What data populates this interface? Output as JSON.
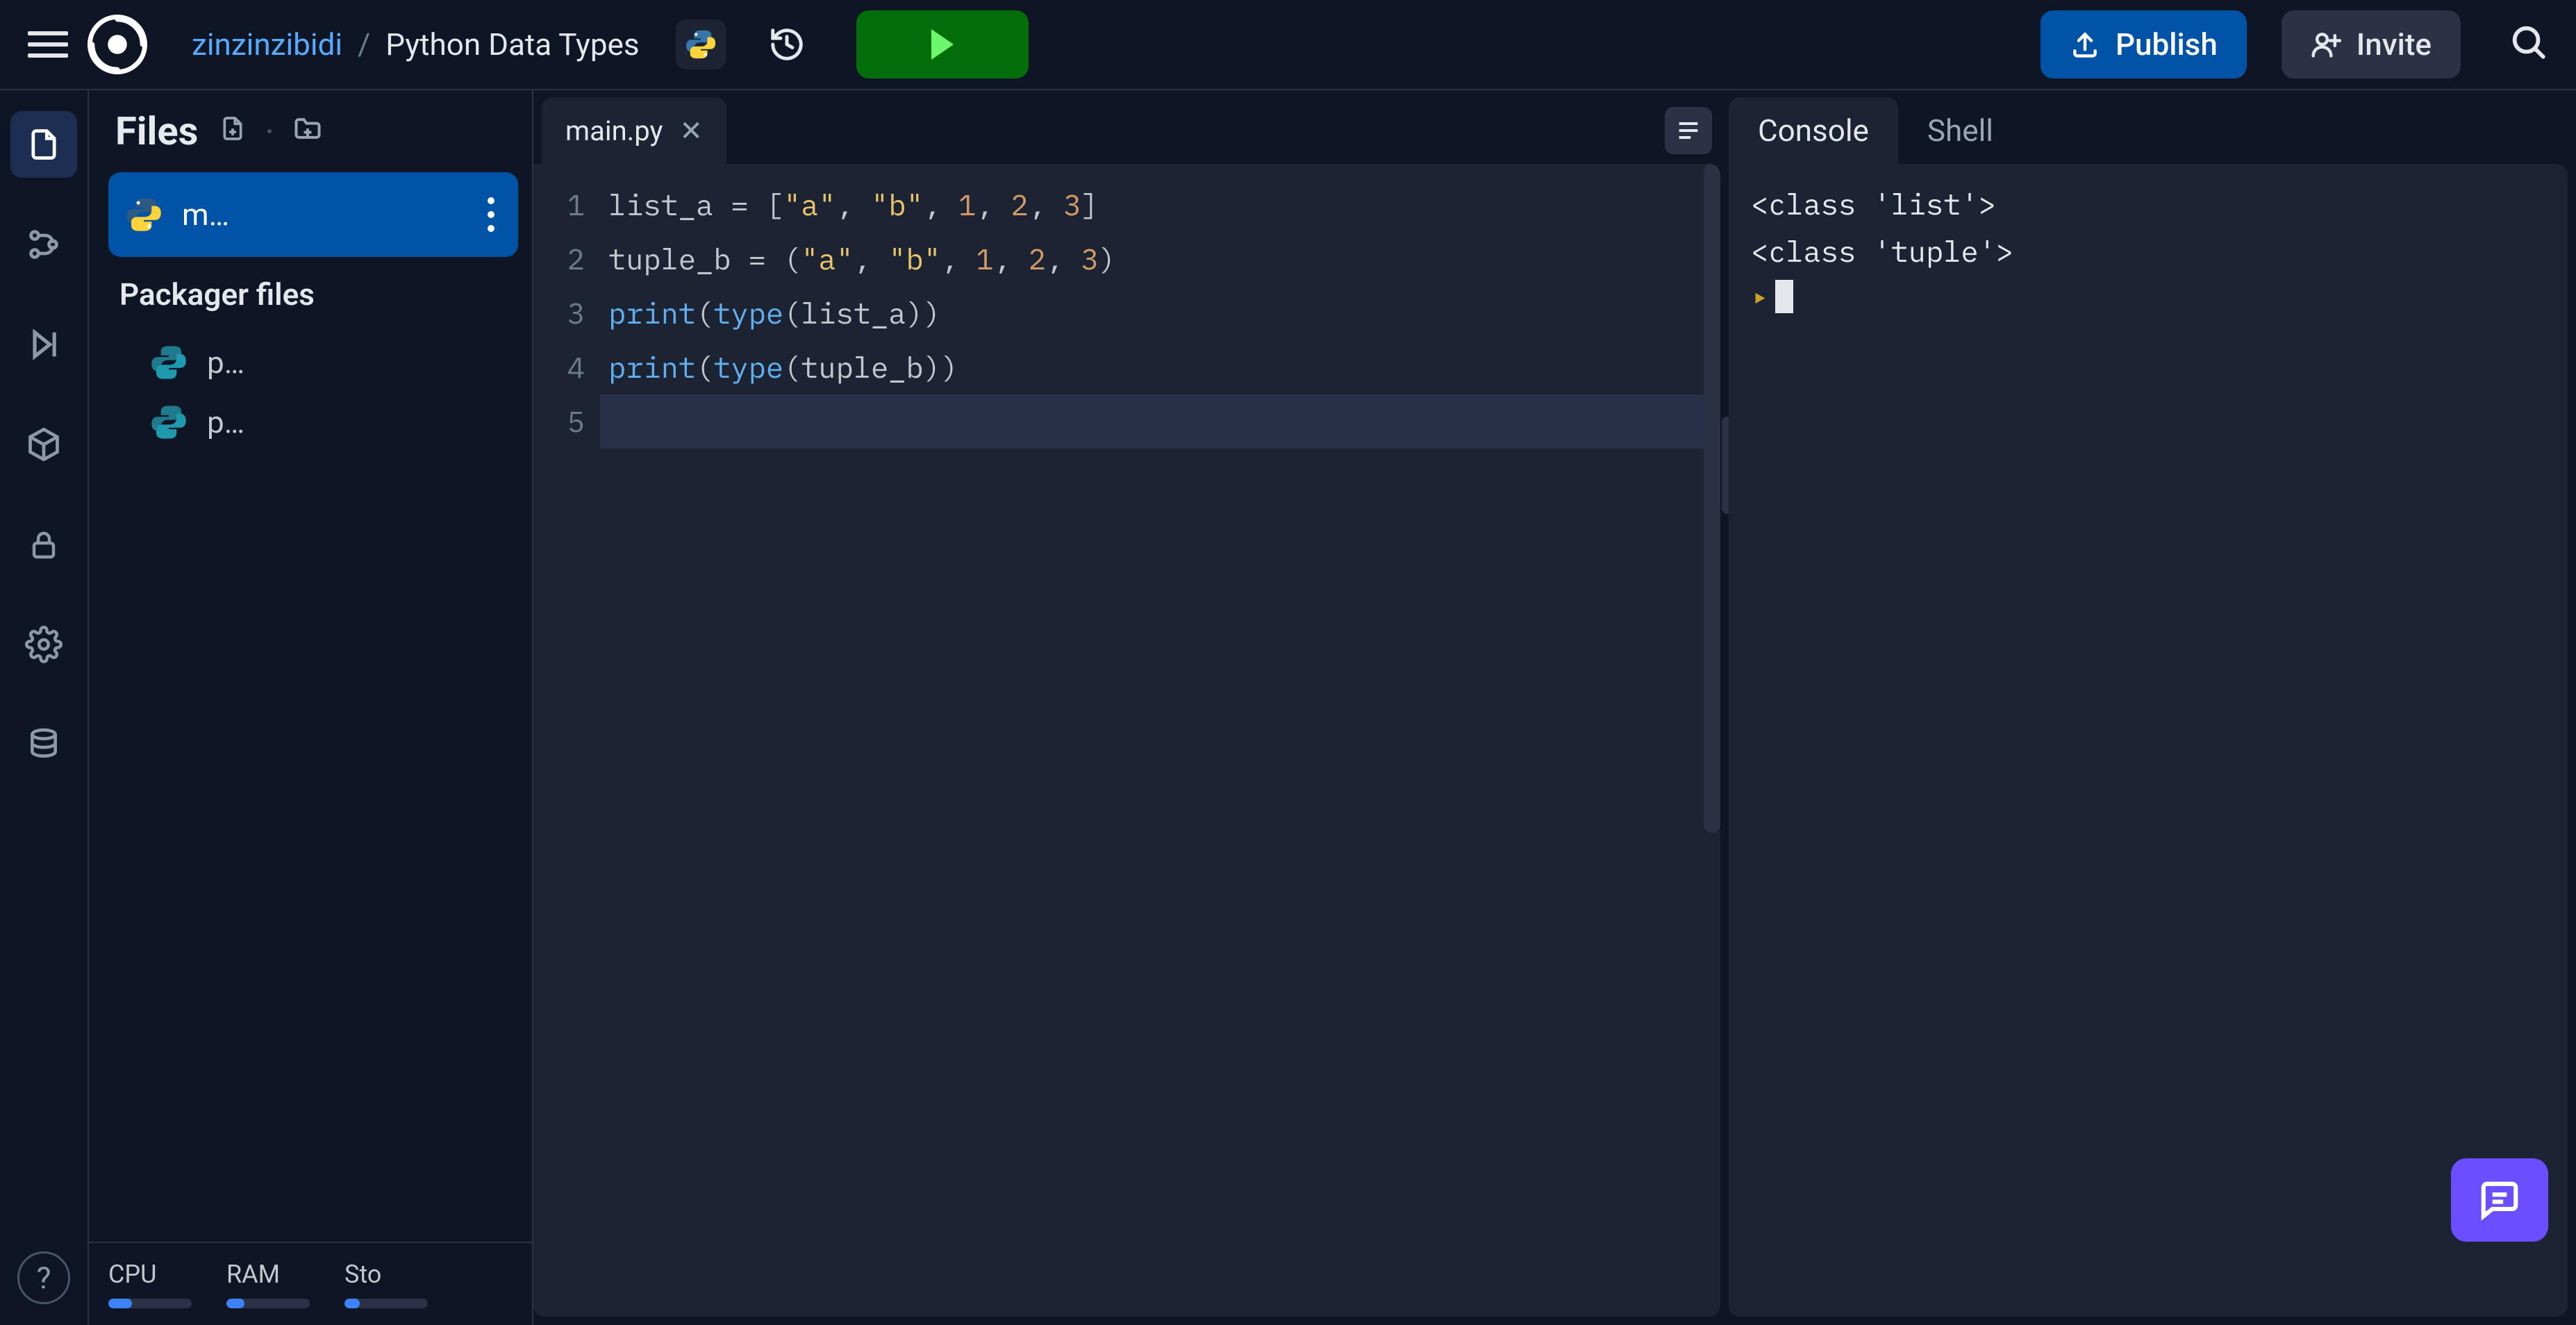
{
  "header": {
    "owner": "zinzinzibidi",
    "separator": "/",
    "title": "Python Data Types",
    "publish_label": "Publish",
    "invite_label": "Invite"
  },
  "sidebar": {
    "title": "Files",
    "active_file": "m…",
    "section_label": "Packager files",
    "packager_files": [
      "p…",
      "p…"
    ],
    "meters": [
      {
        "label": "CPU",
        "pct": 28
      },
      {
        "label": "RAM",
        "pct": 22
      },
      {
        "label": "Sto",
        "pct": 18
      }
    ]
  },
  "editor": {
    "tab_label": "main.py",
    "lines": [
      {
        "n": 1,
        "raw": "list_a = [\"a\", \"b\", 1, 2, 3]"
      },
      {
        "n": 2,
        "raw": "tuple_b = (\"a\", \"b\", 1, 2, 3)"
      },
      {
        "n": 3,
        "raw": "print(type(list_a))"
      },
      {
        "n": 4,
        "raw": "print(type(tuple_b))"
      },
      {
        "n": 5,
        "raw": ""
      }
    ],
    "current_line": 5
  },
  "console": {
    "tabs": [
      "Console",
      "Shell"
    ],
    "active_tab": 0,
    "output": [
      "<class 'list'>",
      "<class 'tuple'>"
    ],
    "prompt": ""
  }
}
